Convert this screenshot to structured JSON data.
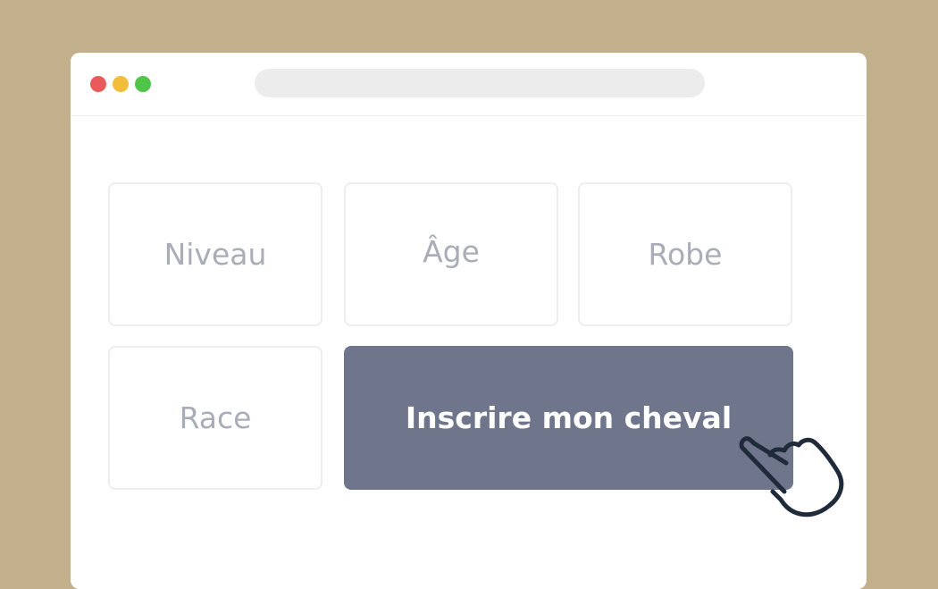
{
  "browser": {
    "controls": {
      "close_color": "#eb5a5a",
      "minimize_color": "#f2bd39",
      "maximize_color": "#4fc64a"
    },
    "address_bar": {
      "value": ""
    }
  },
  "options": [
    {
      "label": "Niveau"
    },
    {
      "label": "Âge"
    },
    {
      "label": "Robe"
    },
    {
      "label": "Race"
    }
  ],
  "cta": {
    "label": "Inscrire mon cheval",
    "color": "#6f768b"
  },
  "cursor": {
    "icon": "pointing-hand-icon"
  }
}
